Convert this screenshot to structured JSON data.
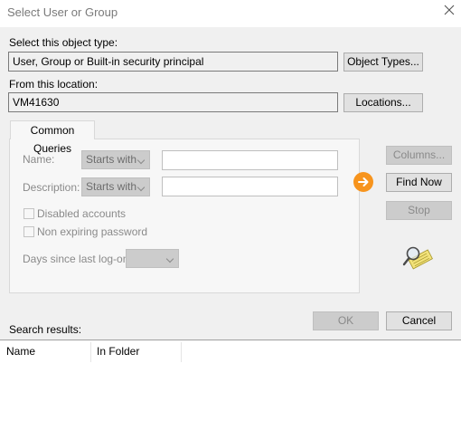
{
  "window": {
    "title": "Select User or Group",
    "close_icon": "close-icon"
  },
  "object_type": {
    "label": "Select this object type:",
    "value": "User, Group or Built-in security principal",
    "button": "Object Types..."
  },
  "location": {
    "label": "From this location:",
    "value": "VM41630",
    "button": "Locations..."
  },
  "queries": {
    "tab": "Common Queries",
    "name_label": "Name:",
    "name_mode": "Starts with",
    "name_value": "",
    "desc_label": "Description:",
    "desc_mode": "Starts with",
    "desc_value": "",
    "disabled_accounts": "Disabled accounts",
    "non_expiring": "Non expiring password",
    "days_label": "Days since last log-on:",
    "days_value": ""
  },
  "buttons": {
    "columns": "Columns...",
    "find_now": "Find Now",
    "stop": "Stop",
    "ok": "OK",
    "cancel": "Cancel"
  },
  "colors": {
    "accent_orange": "#f7941d",
    "dialog_bg": "#f0f0f0"
  },
  "results": {
    "label": "Search results:",
    "columns": [
      "Name",
      "In Folder"
    ]
  }
}
